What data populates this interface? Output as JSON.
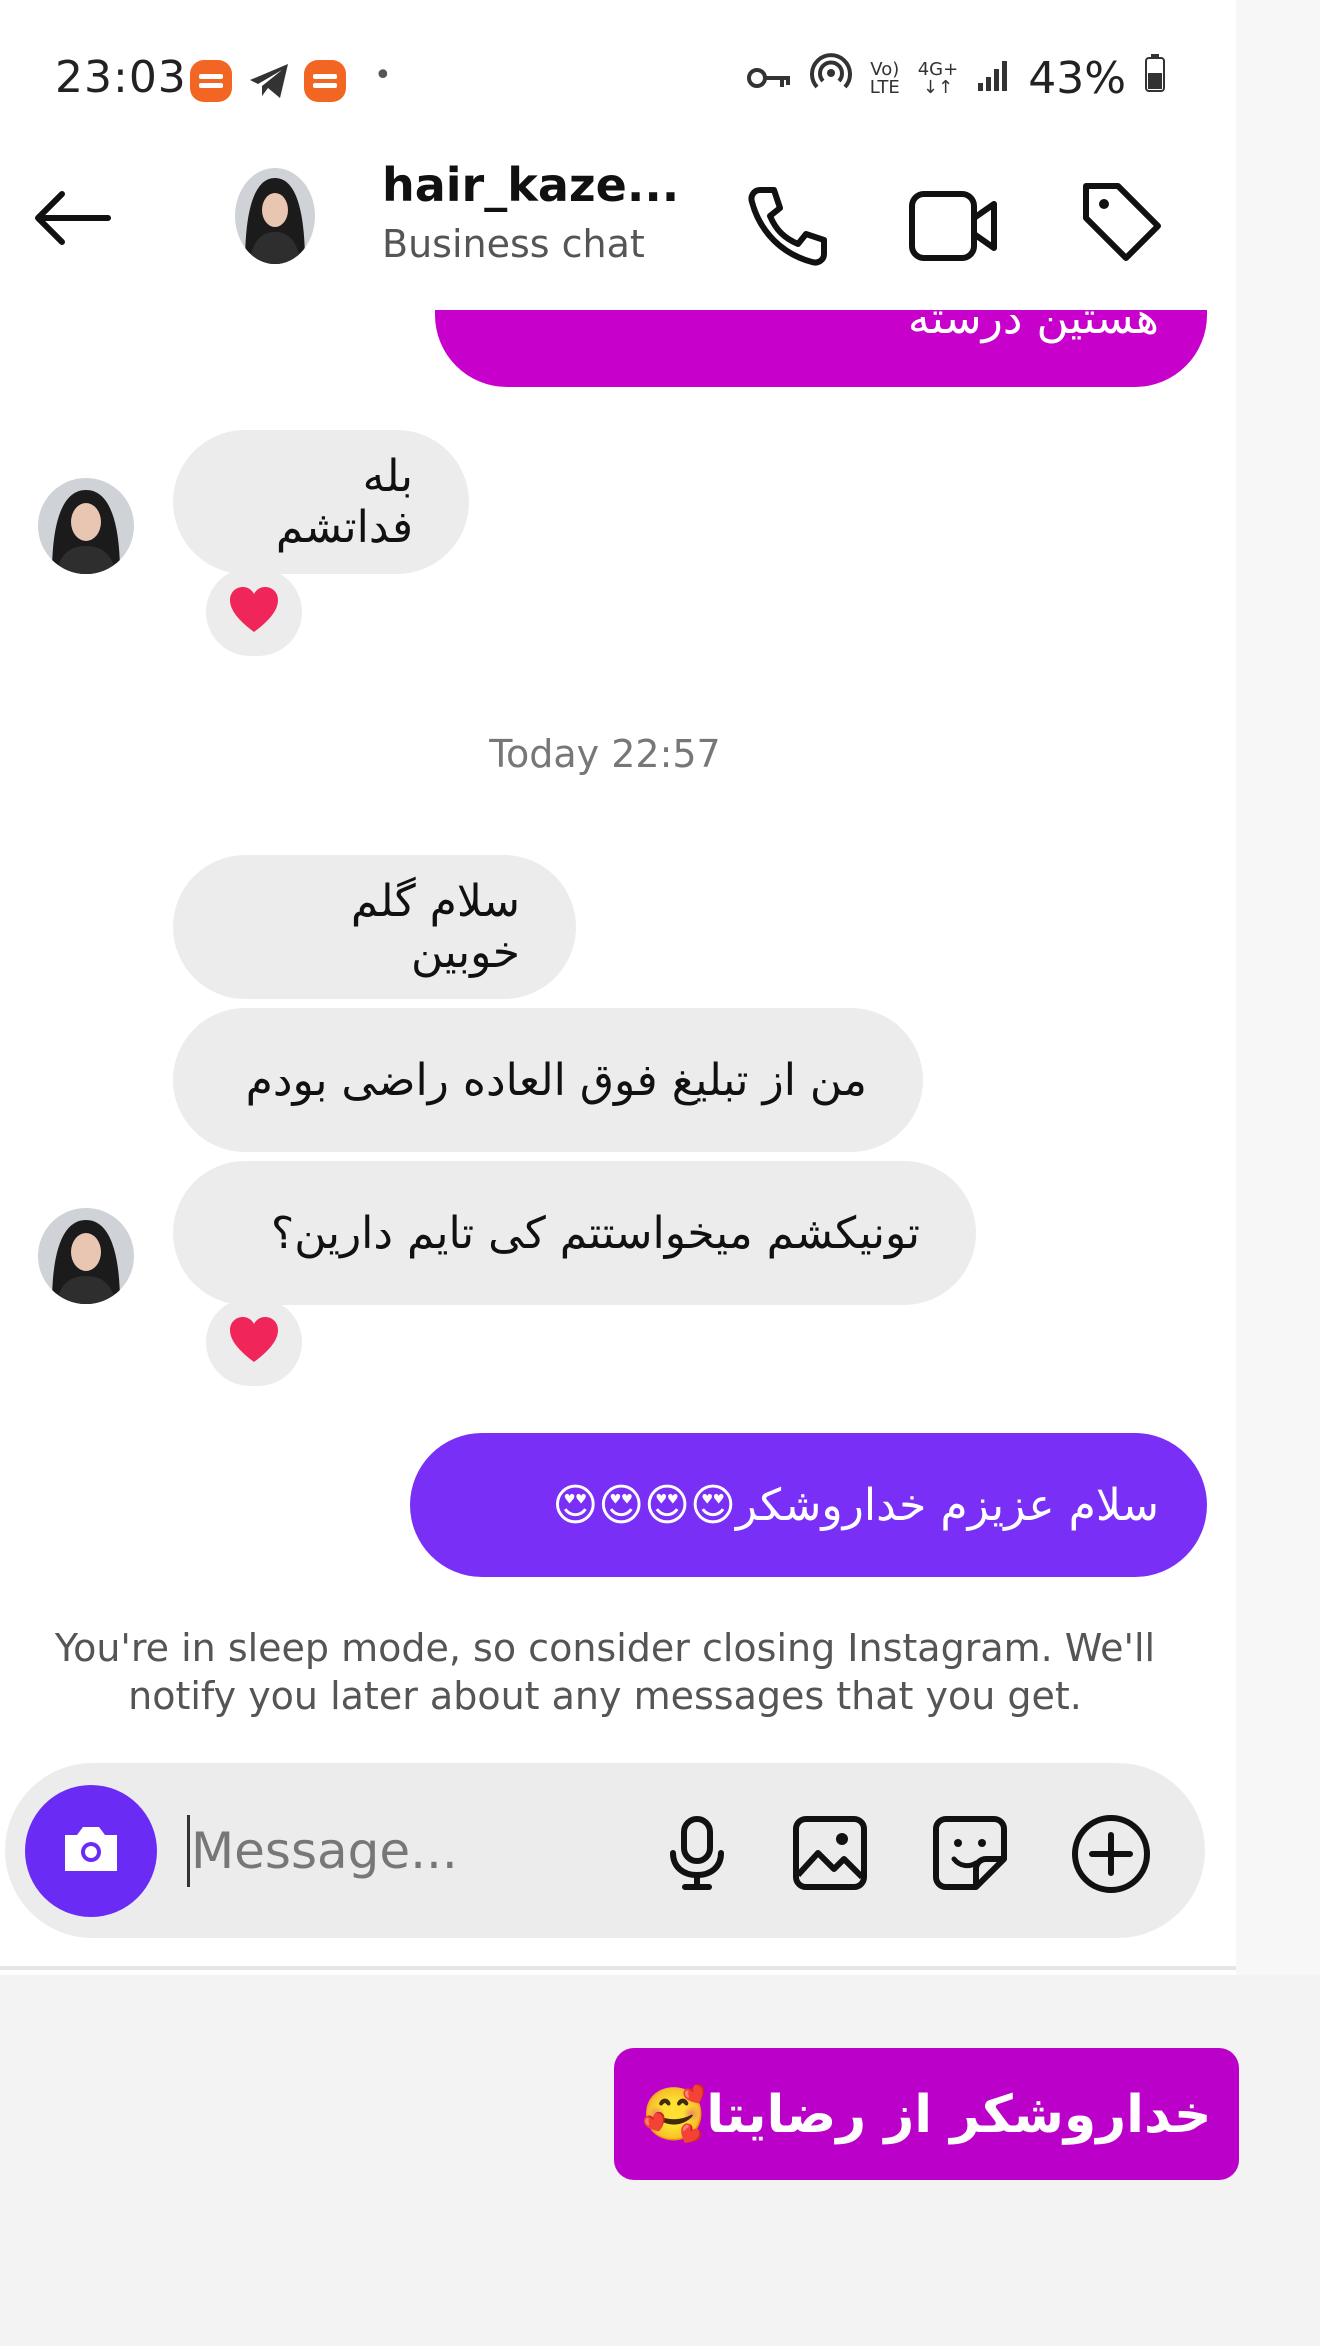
{
  "status_bar": {
    "time": "23:03",
    "dot": "•",
    "network_small_top": "Vo)",
    "network_small_bottom": "LTE",
    "network_4g_top": "4G+",
    "network_4g_bottom": "↓↑",
    "battery": "43%"
  },
  "header": {
    "name": "hair_kaze...",
    "subtitle": "Business chat"
  },
  "messages": {
    "partial_out": "هستین درسته",
    "in_1": "بله فداتشم",
    "timestamp": "Today 22:57",
    "in_2": "سلام گلم خوبین",
    "in_3": "من از تبلیغ فوق العاده راضی بودم",
    "in_4": "تونیکشم میخواستتم کی تایم دارین؟",
    "out_1": "سلام عزیزم خداروشکر😍😍😍😍"
  },
  "sleep_notice": {
    "line1": "You're in sleep mode, so consider closing Instagram. We'll",
    "line2": "notify you later about any messages that you get."
  },
  "composer": {
    "placeholder": "Message..."
  },
  "overlay": {
    "sticker_text": "خداروشکر از رضایتا🥰"
  },
  "colors": {
    "purple": "#6a2cf5",
    "magenta": "#bb00c9",
    "bubble_in": "#ececec",
    "heart": "#f0265a"
  },
  "icons": [
    "back-arrow-icon",
    "phone-icon",
    "video-icon",
    "tag-icon",
    "camera-icon",
    "microphone-icon",
    "gallery-icon",
    "sticker-icon",
    "plus-icon",
    "heart-icon",
    "key-icon",
    "hotspot-icon",
    "signal-icon",
    "battery-icon",
    "telegram-icon"
  ]
}
